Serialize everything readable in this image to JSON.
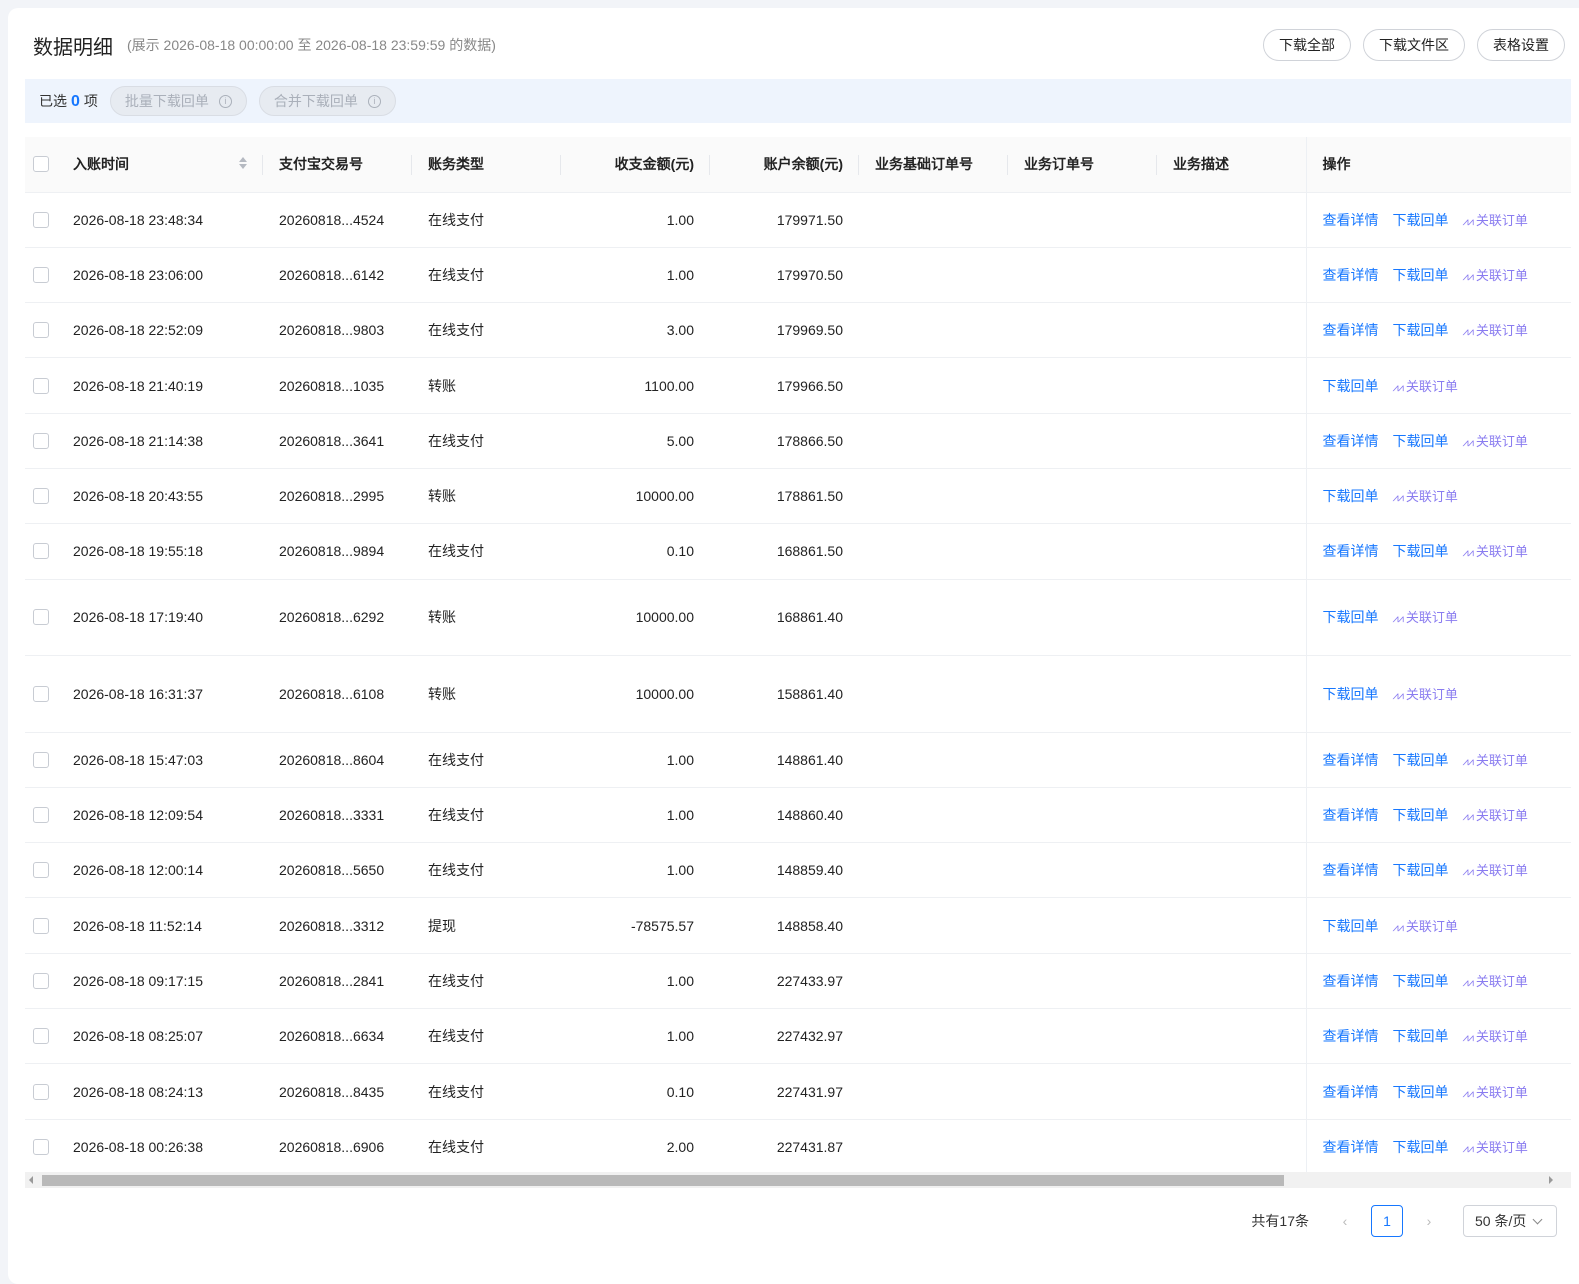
{
  "header": {
    "title": "数据明细",
    "subtitle": "(展示 2026-08-18 00:00:00 至 2026-08-18 23:59:59 的数据)",
    "actions": [
      "下载全部",
      "下载文件区",
      "表格设置"
    ]
  },
  "selection": {
    "prefix": "已选",
    "count": "0",
    "suffix": "项",
    "batch_download": "批量下载回单",
    "merge_download": "合并下载回单"
  },
  "table": {
    "columns": [
      "入账时间",
      "支付宝交易号",
      "账务类型",
      "收支金额(元)",
      "账户余额(元)",
      "业务基础订单号",
      "业务订单号",
      "业务描述",
      "操作"
    ],
    "action_labels": {
      "detail": "查看详情",
      "download": "下载回单",
      "link": "关联订单"
    },
    "rows": [
      {
        "time": "2026-08-18 23:48:34",
        "trade_no": "20260818...4524",
        "type": "在线支付",
        "amount": "1.00",
        "balance": "179971.50",
        "base_order": "",
        "order": "",
        "desc": "",
        "has_detail": true
      },
      {
        "time": "2026-08-18 23:06:00",
        "trade_no": "20260818...6142",
        "type": "在线支付",
        "amount": "1.00",
        "balance": "179970.50",
        "base_order": "",
        "order": "",
        "desc": "",
        "has_detail": true
      },
      {
        "time": "2026-08-18 22:52:09",
        "trade_no": "20260818...9803",
        "type": "在线支付",
        "amount": "3.00",
        "balance": "179969.50",
        "base_order": "",
        "order": "",
        "desc": "",
        "has_detail": true
      },
      {
        "time": "2026-08-18 21:40:19",
        "trade_no": "20260818...1035",
        "type": "转账",
        "amount": "1100.00",
        "balance": "179966.50",
        "base_order": "",
        "order": "",
        "desc": "",
        "has_detail": false
      },
      {
        "time": "2026-08-18 21:14:38",
        "trade_no": "20260818...3641",
        "type": "在线支付",
        "amount": "5.00",
        "balance": "178866.50",
        "base_order": "",
        "order": "",
        "desc": "",
        "has_detail": true
      },
      {
        "time": "2026-08-18 20:43:55",
        "trade_no": "20260818...2995",
        "type": "转账",
        "amount": "10000.00",
        "balance": "178861.50",
        "base_order": "",
        "order": "",
        "desc": "",
        "has_detail": false
      },
      {
        "time": "2026-08-18 19:55:18",
        "trade_no": "20260818...9894",
        "type": "在线支付",
        "amount": "0.10",
        "balance": "168861.50",
        "base_order": "",
        "order": "",
        "desc": "",
        "has_detail": true
      },
      {
        "time": "2026-08-18 17:19:40",
        "trade_no": "20260818...6292",
        "type": "转账",
        "amount": "10000.00",
        "balance": "168861.40",
        "base_order": "",
        "order": "",
        "desc": "",
        "has_detail": false,
        "tall": true
      },
      {
        "time": "2026-08-18 16:31:37",
        "trade_no": "20260818...6108",
        "type": "转账",
        "amount": "10000.00",
        "balance": "158861.40",
        "base_order": "",
        "order": "",
        "desc": "",
        "has_detail": false,
        "tall": true
      },
      {
        "time": "2026-08-18 15:47:03",
        "trade_no": "20260818...8604",
        "type": "在线支付",
        "amount": "1.00",
        "balance": "148861.40",
        "base_order": "",
        "order": "",
        "desc": "",
        "has_detail": true
      },
      {
        "time": "2026-08-18 12:09:54",
        "trade_no": "20260818...3331",
        "type": "在线支付",
        "amount": "1.00",
        "balance": "148860.40",
        "base_order": "",
        "order": "",
        "desc": "",
        "has_detail": true
      },
      {
        "time": "2026-08-18 12:00:14",
        "trade_no": "20260818...5650",
        "type": "在线支付",
        "amount": "1.00",
        "balance": "148859.40",
        "base_order": "",
        "order": "",
        "desc": "",
        "has_detail": true
      },
      {
        "time": "2026-08-18 11:52:14",
        "trade_no": "20260818...3312",
        "type": "提现",
        "amount": "-78575.57",
        "balance": "148858.40",
        "base_order": "",
        "order": "",
        "desc": "",
        "has_detail": false
      },
      {
        "time": "2026-08-18 09:17:15",
        "trade_no": "20260818...2841",
        "type": "在线支付",
        "amount": "1.00",
        "balance": "227433.97",
        "base_order": "",
        "order": "",
        "desc": "",
        "has_detail": true
      },
      {
        "time": "2026-08-18 08:25:07",
        "trade_no": "20260818...6634",
        "type": "在线支付",
        "amount": "1.00",
        "balance": "227432.97",
        "base_order": "",
        "order": "",
        "desc": "",
        "has_detail": true
      },
      {
        "time": "2026-08-18 08:24:13",
        "trade_no": "20260818...8435",
        "type": "在线支付",
        "amount": "0.10",
        "balance": "227431.97",
        "base_order": "",
        "order": "",
        "desc": "",
        "has_detail": true
      },
      {
        "time": "2026-08-18 00:26:38",
        "trade_no": "20260818...6906",
        "type": "在线支付",
        "amount": "2.00",
        "balance": "227431.87",
        "base_order": "",
        "order": "",
        "desc": "",
        "has_detail": true
      }
    ]
  },
  "pagination": {
    "total": "共有17条",
    "current": "1",
    "page_size": "50 条/页"
  },
  "colors": {
    "primary": "#1677ff",
    "ai": "#8a7cf0",
    "selbar_bg": "#eef4fd"
  }
}
